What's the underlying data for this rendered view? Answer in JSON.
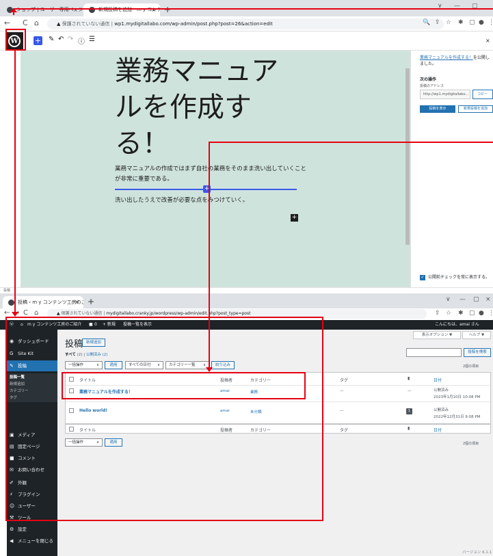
{
  "top": {
    "tabs": [
      {
        "label": "ショップ | ユーザー専用ページ - WordPress",
        "close": "×"
      },
      {
        "label": "新規投稿を追加 - m y コンテンツ",
        "close": "×"
      }
    ],
    "new_tab": "+",
    "window_controls": [
      "∨",
      "—",
      "▢"
    ],
    "address": {
      "warning": "保護されていない通信",
      "url": "wp1.mydigitallabo.com/wp-admin/post.php?post=26&action=edit"
    },
    "editor_close": "×",
    "post_title": "業務マニュアルを作成する！",
    "paragraph_1": "業務マニュアルの作成ではまず自社の業務をそのまま洗い出していくことが非常に重要である。",
    "paragraph_2": "洗い出したうえで改善が必要な点をみつけていく。",
    "sidebar": {
      "published_link": "業務マニュアルを作成する！",
      "published_suffix": "を公開しました。",
      "next_heading": "次の操作",
      "address_label": "投稿のアドレス",
      "address_value": "http://wp1.mydigitallabo...",
      "copy_button": "コピー",
      "view_post_button": "投稿を表示",
      "add_new_button": "新規投稿を追加",
      "always_show_label": "公開前チェックを常に表示する。"
    },
    "status_text": "投稿"
  },
  "bottom": {
    "tabs": [
      {
        "label": "投稿 ‹ m y コンテンツ工房のご紹介 —",
        "close": "×"
      }
    ],
    "new_tab": "+",
    "window_controls": [
      "∨",
      "—",
      "▢",
      "×"
    ],
    "address": {
      "warning": "保護されていない通信",
      "url": "mydigitallabo.cranky.jp/wordpress/wp-admin/edit.php?post_type=post"
    },
    "adminbar": {
      "site": "m y コンテンツ工房のご紹介",
      "comments": "0",
      "new": "+ 新規",
      "view": "投稿一覧を表示",
      "greeting": "こんにちは、amai さん"
    },
    "menu": [
      {
        "label": "ダッシュボード",
        "icon": "dashboard-icon"
      },
      {
        "label": "Site Kit",
        "icon": "sitekit-icon"
      },
      {
        "label": "投稿",
        "icon": "pin-icon"
      },
      {
        "label": "メディア",
        "icon": "media-icon"
      },
      {
        "label": "固定ページ",
        "icon": "page-icon"
      },
      {
        "label": "コメント",
        "icon": "comment-icon"
      },
      {
        "label": "お問い合わせ",
        "icon": "mail-icon"
      },
      {
        "label": "外観",
        "icon": "brush-icon"
      },
      {
        "label": "プラグイン",
        "icon": "plugin-icon"
      },
      {
        "label": "ユーザー",
        "icon": "user-icon"
      },
      {
        "label": "ツール",
        "icon": "wrench-icon"
      },
      {
        "label": "設定",
        "icon": "settings-icon"
      },
      {
        "label": "メニューを閉じる",
        "icon": "collapse-icon"
      }
    ],
    "submenu": [
      "投稿一覧",
      "新規追加",
      "カテゴリー",
      "タグ"
    ],
    "page_title": "投稿",
    "add_new": "新規追加",
    "screen_options": "表示オプション ▼",
    "help": "ヘルプ ▼",
    "search_button": "投稿を検索",
    "subsub_all": "すべて",
    "subsub_all_count": "(2)",
    "subsub_sep": "|",
    "subsub_published": "公開済み (2)",
    "bulk_action": "一括操作",
    "apply": "適用",
    "all_dates": "すべての日付",
    "all_categories": "カテゴリー一覧",
    "filter": "絞り込み",
    "items_count": "2個の項目",
    "columns": {
      "title": "タイトル",
      "author": "投稿者",
      "categories": "カテゴリー",
      "tags": "タグ",
      "date": "日付"
    },
    "rows": [
      {
        "title": "業務マニュアルを作成する！",
        "author": "amai",
        "category": "業務",
        "tags": "—",
        "comments": "—",
        "status": "公開済み",
        "date": "2023年1月10日 10:08 PM"
      },
      {
        "title": "Hello world!",
        "author": "amai",
        "category": "未分類",
        "tags": "—",
        "comments": "1",
        "status": "公開済み",
        "date": "2022年12月31日 9:08 PM"
      }
    ],
    "version": "バージョン 6.1.1"
  }
}
